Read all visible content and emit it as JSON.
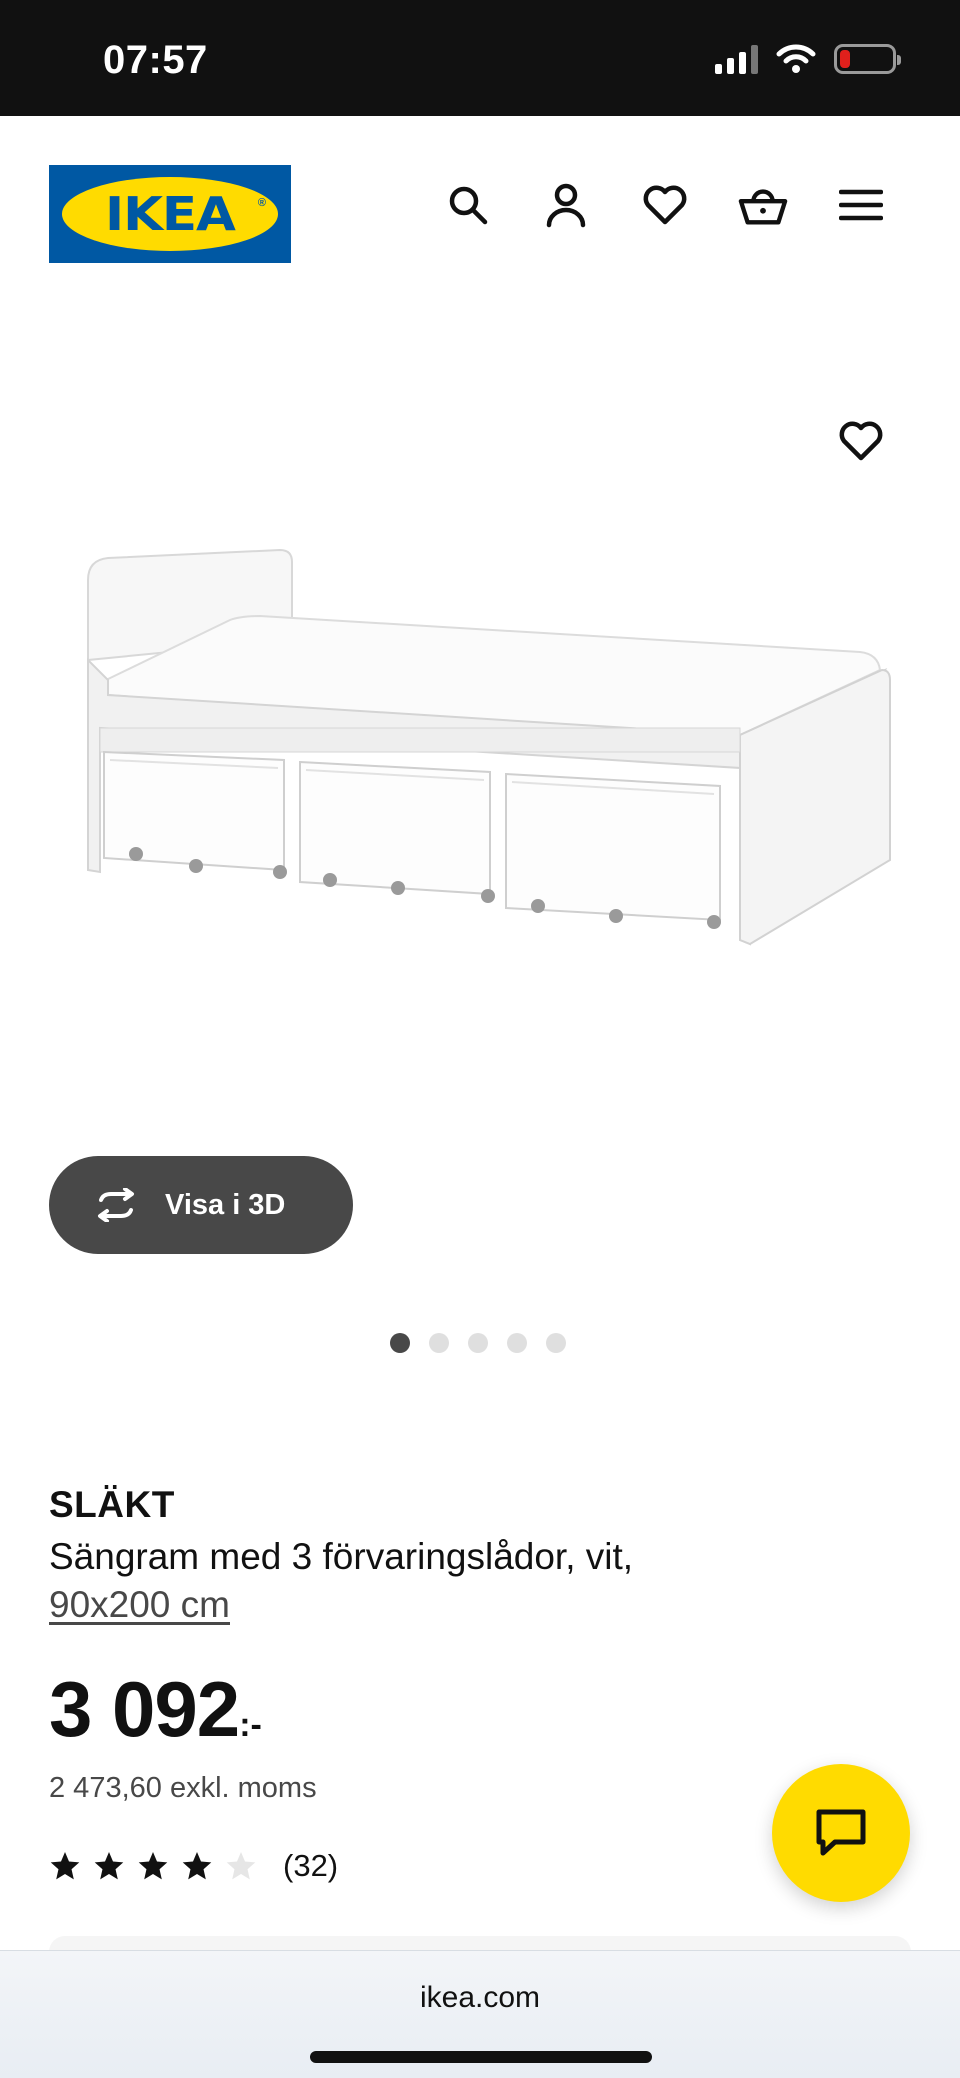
{
  "status_bar": {
    "time": "07:57",
    "icons": [
      "cellular-signal-icon",
      "wifi-icon",
      "battery-low-icon"
    ]
  },
  "header": {
    "logo_text": "IKEA",
    "logo_colors": {
      "blue": "#0058a3",
      "yellow": "#ffdb00"
    },
    "icons": [
      "search-icon",
      "user-icon",
      "heart-icon",
      "shopping-basket-icon",
      "menu-icon"
    ]
  },
  "gallery": {
    "wishlist_icon": "heart-icon",
    "view_3d_label": "Visa i 3D",
    "view_3d_icon": "rotate-arrows-icon",
    "total_images": 5,
    "active_index": 0
  },
  "product": {
    "name": "SLÄKT",
    "description": "Sängram med 3 förvaringslådor, vit,",
    "size": "90x200 cm",
    "price": "3 092",
    "price_suffix": ":-",
    "price_exkl": "2 473,60 exkl. moms",
    "rating": 4,
    "rating_max": 5,
    "review_count": "(32)"
  },
  "chat": {
    "icon": "chat-bubble-icon",
    "color": "#ffdb00"
  },
  "browser": {
    "url": "ikea.com"
  }
}
